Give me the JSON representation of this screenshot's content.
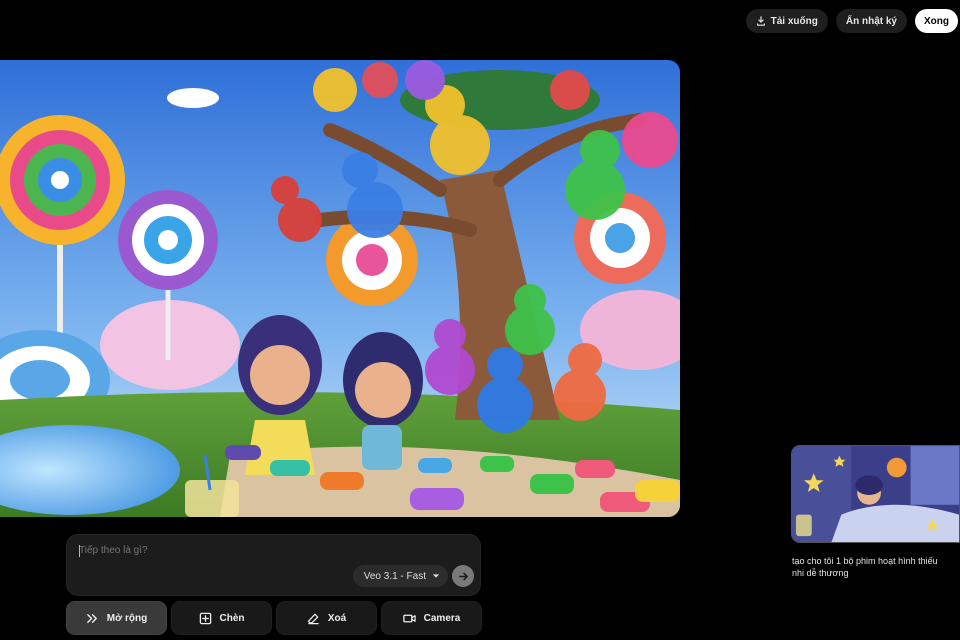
{
  "header": {
    "download_label": "Tải xuống",
    "hide_log_label": "Ẩn nhật ký",
    "done_label": "Xong",
    "download_icon": "download-icon"
  },
  "video": {
    "scene": "candy-land-gummy-bear-tree"
  },
  "prompt": {
    "placeholder": "Tiếp theo là gì?",
    "value": "",
    "model_label": "Veo 3.1 - Fast",
    "model_icon": "chevron-down-icon",
    "send_icon": "arrow-right-icon"
  },
  "actions": [
    {
      "label": "Mở rộng",
      "icon": "expand-icon",
      "active": true
    },
    {
      "label": "Chèn",
      "icon": "plus-box-icon",
      "active": false
    },
    {
      "label": "Xoá",
      "icon": "eraser-icon",
      "active": false
    },
    {
      "label": "Camera",
      "icon": "camera-icon",
      "active": false
    }
  ],
  "history": {
    "caption": "tạo cho tôi 1 bộ phim hoạt hình thiếu nhi dễ thương"
  },
  "colors": {
    "background": "#000000",
    "panel": "#1c1c1c",
    "button": "#191919",
    "button_active": "#3a3a3a",
    "light_button": "#ffffff"
  }
}
